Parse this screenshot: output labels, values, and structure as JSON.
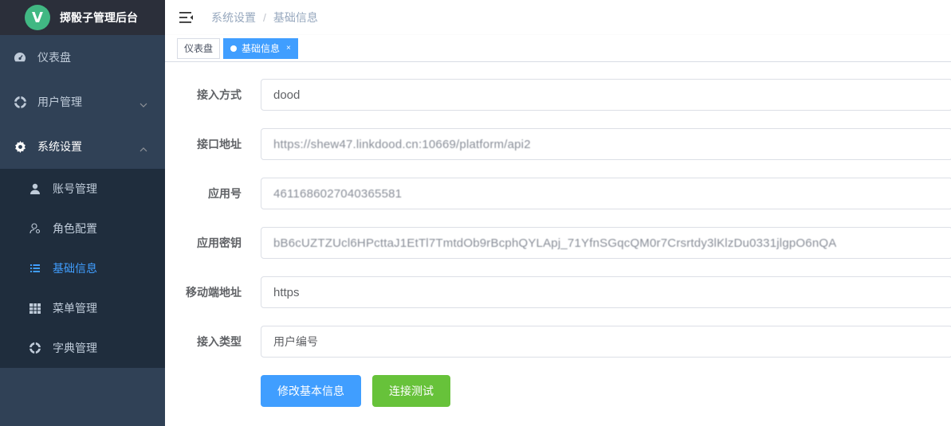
{
  "app": {
    "title": "掷骰子管理后台",
    "logo_letter": "V"
  },
  "sidebar": {
    "dashboard": "仪表盘",
    "user_mgmt": "用户管理",
    "system": "系统设置",
    "sub": {
      "account": "账号管理",
      "role": "角色配置",
      "basic": "基础信息",
      "menu": "菜单管理",
      "dict": "字典管理"
    }
  },
  "breadcrumb": {
    "level1": "系统设置",
    "separator": "/",
    "level2": "基础信息"
  },
  "tags": {
    "dashboard": "仪表盘",
    "basic": "基础信息",
    "close": "×"
  },
  "form": {
    "access_mode": {
      "label": "接入方式",
      "value": "dood"
    },
    "api_url": {
      "label": "接口地址",
      "value": "https://shew47.linkdood.cn:10669/platform/api2"
    },
    "app_id": {
      "label": "应用号",
      "value": "4611686027040365581"
    },
    "app_secret": {
      "label": "应用密钥",
      "value": "bB6cUZTZUcl6HPcttaJ1EtTl7TmtdOb9rBcphQYLApj_71YfnSGqcQM0r7Crsrtdy3lKlzDu0331jlgpO6nQA"
    },
    "mobile_url": {
      "label": "移动端地址",
      "value": "https"
    },
    "access_type": {
      "label": "接入类型",
      "value": "用户编号"
    }
  },
  "buttons": {
    "edit": "修改基本信息",
    "test": "连接测试"
  },
  "colors": {
    "sidebar": "#304156",
    "submenu": "#1f2d3d",
    "primary": "#409eff",
    "success": "#67c23a",
    "logo": "#41b883"
  }
}
